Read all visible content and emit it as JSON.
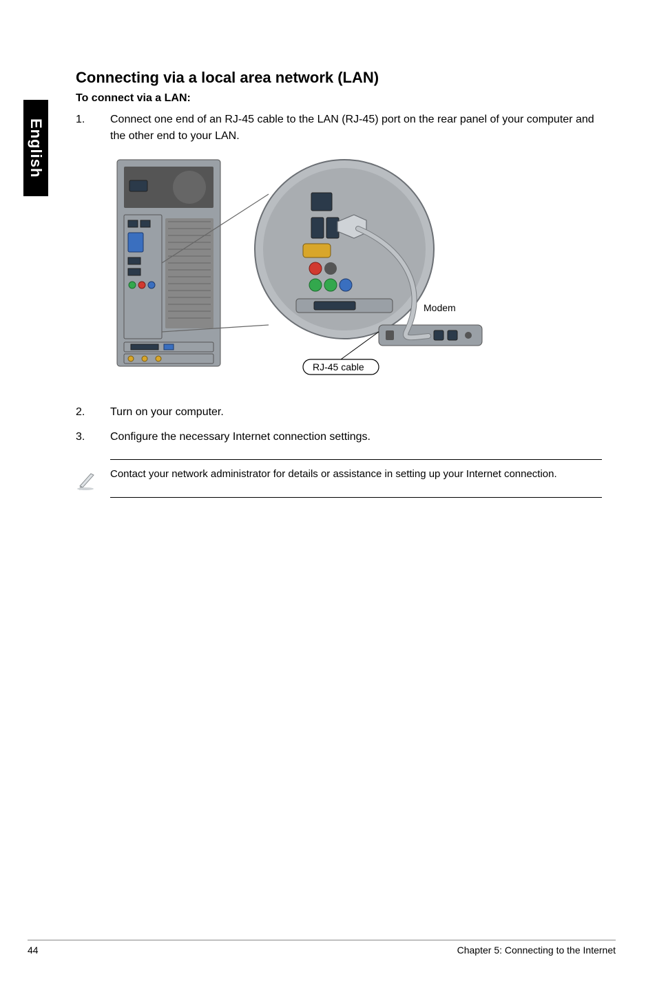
{
  "sideTab": {
    "label": "English"
  },
  "heading": "Connecting via a local area network (LAN)",
  "subheading": "To connect via a LAN:",
  "steps": [
    {
      "num": "1.",
      "text": "Connect one end of an RJ-45 cable to the LAN (RJ-45) port on the rear panel of your computer and the other end to your LAN."
    },
    {
      "num": "2.",
      "text": "Turn on your computer."
    },
    {
      "num": "3.",
      "text": "Configure the necessary Internet connection settings."
    }
  ],
  "figure": {
    "modemLabel": "Modem",
    "cableLabel": "RJ-45 cable"
  },
  "note": {
    "text": "Contact your network administrator for details or assistance in setting up your Internet connection."
  },
  "footer": {
    "pageNumber": "44",
    "chapter": "Chapter 5: Connecting to the Internet"
  }
}
